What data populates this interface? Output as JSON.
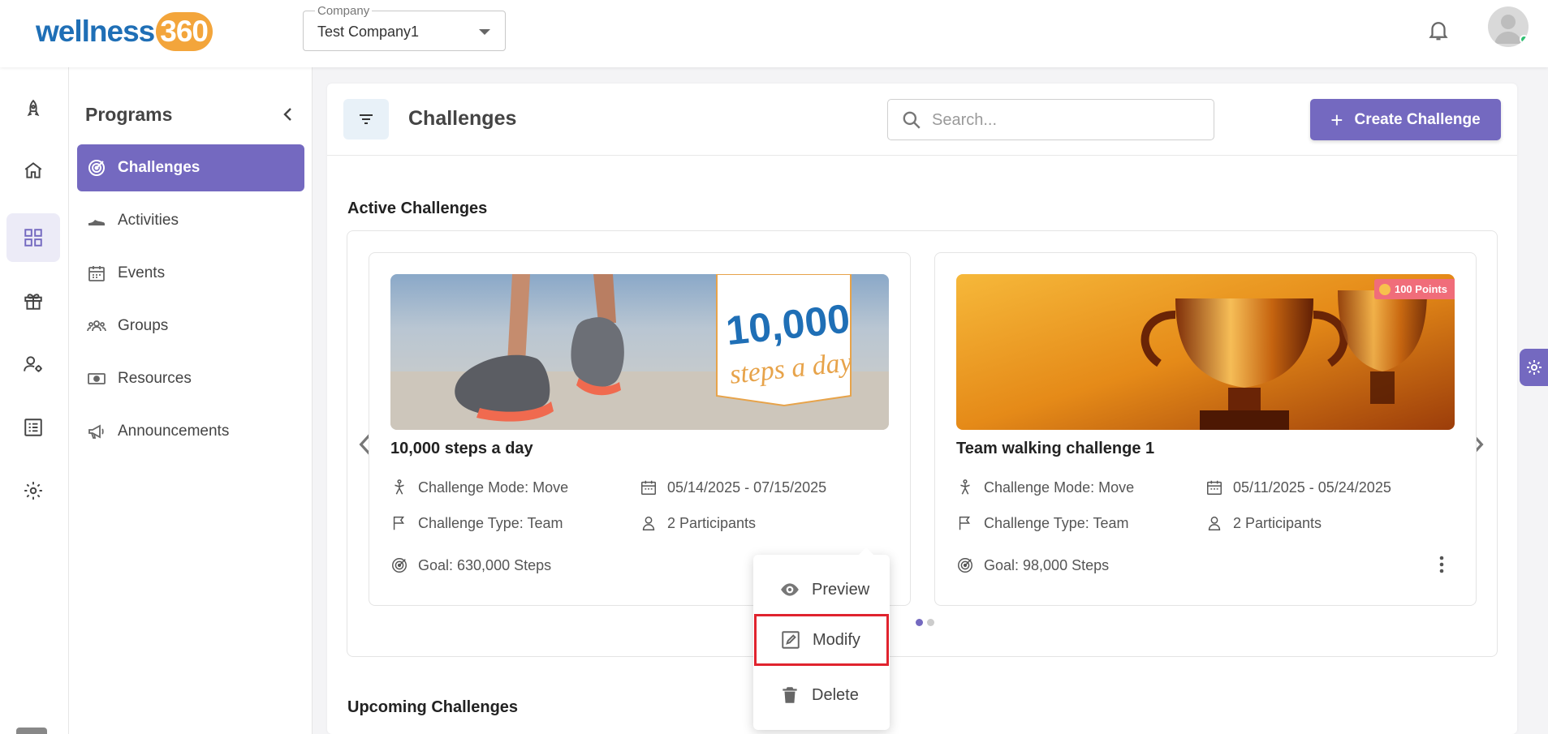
{
  "brand": {
    "logo_word": "wellness",
    "logo_number": "360"
  },
  "company": {
    "label": "Company",
    "value": "Test Company1"
  },
  "icons": {
    "rail": [
      "rocket-icon",
      "home-icon",
      "grid-icon",
      "gift-icon",
      "user-gear-icon",
      "list-icon",
      "gear-icon"
    ],
    "bell": "bell-icon"
  },
  "programs": {
    "title": "Programs",
    "items": [
      {
        "label": "Challenges",
        "icon": "target-icon",
        "active": true
      },
      {
        "label": "Activities",
        "icon": "shoe-icon"
      },
      {
        "label": "Events",
        "icon": "calendar-icon"
      },
      {
        "label": "Groups",
        "icon": "groups-icon"
      },
      {
        "label": "Resources",
        "icon": "money-icon"
      },
      {
        "label": "Announcements",
        "icon": "megaphone-icon"
      }
    ]
  },
  "main": {
    "title": "Challenges",
    "search_placeholder": "Search...",
    "create_label": "Create Challenge",
    "active_title": "Active Challenges",
    "upcoming_title": "Upcoming Challenges"
  },
  "cards": [
    {
      "name": "10,000 steps a day",
      "image_text_1": "10,000",
      "image_text_2": "steps a day",
      "mode": "Challenge Mode: Move",
      "dates": "05/14/2025 - 07/15/2025",
      "type": "Challenge Type: Team",
      "participants": "2 Participants",
      "goal": "Goal: 630,000 Steps"
    },
    {
      "name": "Team walking challenge 1",
      "badge": "100 Points",
      "mode": "Challenge Mode: Move",
      "dates": "05/11/2025 - 05/24/2025",
      "type": "Challenge Type: Team",
      "participants": "2 Participants",
      "goal": "Goal: 98,000 Steps"
    }
  ],
  "menu": {
    "preview": "Preview",
    "modify": "Modify",
    "delete": "Delete"
  },
  "colors": {
    "accent": "#7469c0",
    "highlight": "#e0232e",
    "logo_blue": "#1f6fb6",
    "logo_orange": "#f3a53b"
  }
}
